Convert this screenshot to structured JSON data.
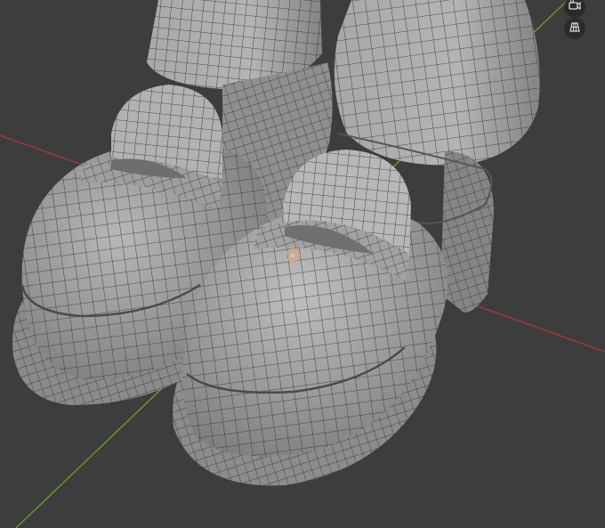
{
  "viewport": {
    "background": "#3d3d3d",
    "axis_x_color": "#a33a3a",
    "axis_y_color": "#6a9a2a",
    "mesh_fill": "#9a9a9a",
    "mesh_fill_light": "#b4b4b4",
    "wire_color": "#2a2a2a",
    "origin_color": "#e6a07a"
  },
  "navigation": {
    "camera_icon": "camera-view-icon",
    "grid_icon": "ortho-grid-icon"
  }
}
